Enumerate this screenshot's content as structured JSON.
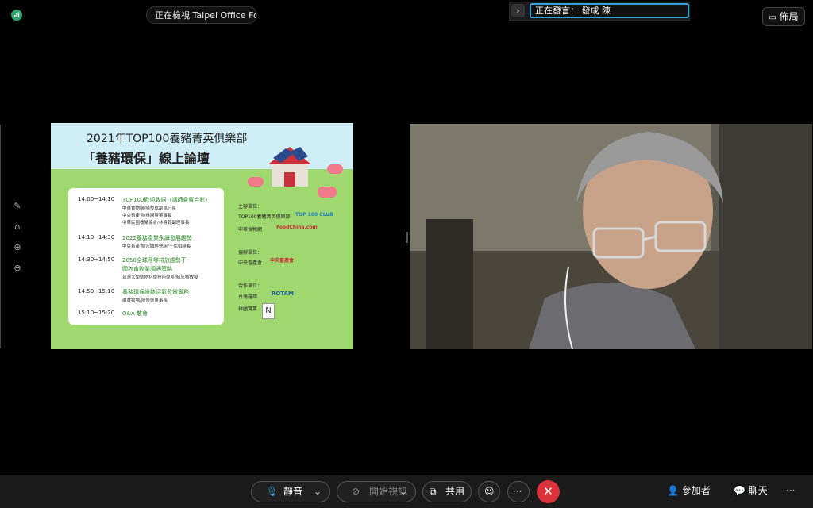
{
  "topbar": {
    "viewing_text": "正在檢視 Taipei Office Fo...",
    "speaking_text": "正在發言： 發成 陳",
    "layout_label": "佈局"
  },
  "slide": {
    "title_line1": "2021年TOP100養豬菁英俱樂部",
    "title_line2": "「養豬環保」線上論壇",
    "agenda": [
      {
        "time": "14:00~14:10",
        "title": "TOP100歡迎致詞（講師貴賓合影）",
        "subs": [
          "中華食物網/陳發成副執行長",
          "中央畜產會/林團賢董事長",
          "中華民國養豬協會/林睿毅副理事長"
        ]
      },
      {
        "time": "14:10~14:30",
        "title": "2022養豬產業永續發展趨勢",
        "subs": [
          "中央畜產會/永續經營組/王佑相組長"
        ]
      },
      {
        "time": "14:30~14:50",
        "title": "2050全球淨零排放趨勢下",
        "title2": "國內畜牧業調適策略",
        "subs": [
          "台灣大學動物科學技術學系/蘇忠楨教授"
        ]
      },
      {
        "time": "14:50~15:10",
        "title": "養豬環保綠能沼氣發電實務",
        "subs": [
          "瀛寶牧場/陳修盛董事長"
        ]
      },
      {
        "time": "15:10~15:20",
        "title": "Q&A  散會",
        "subs": []
      }
    ],
    "organizers": {
      "host_label": "主辦單位：",
      "host1": "TOP100養豬菁英俱樂部",
      "host1_logo": "TOP 100 CLUB",
      "host2": "中華食物網",
      "host2_logo": "FoodChina.com",
      "co_label": "協辦單位：",
      "co1": "中央畜產會",
      "co1_logo": "中央畜產會",
      "partner_label": "合作單位：",
      "partner1": "台灣羅譚",
      "partner1_logo": "ROTAM",
      "partner2": "祥圃實業"
    }
  },
  "toolbar": {
    "mute_label": "靜音",
    "video_label": "開始視訊",
    "share_label": "共用",
    "more_label": "···",
    "participants_label": "參加者",
    "chat_label": "聊天",
    "overflow_label": "···"
  },
  "colors": {
    "hangup": "#d9323a",
    "speaker_border": "#3aa0d8",
    "slide_green": "#9fd86e",
    "slide_sky": "#cfeef7"
  }
}
